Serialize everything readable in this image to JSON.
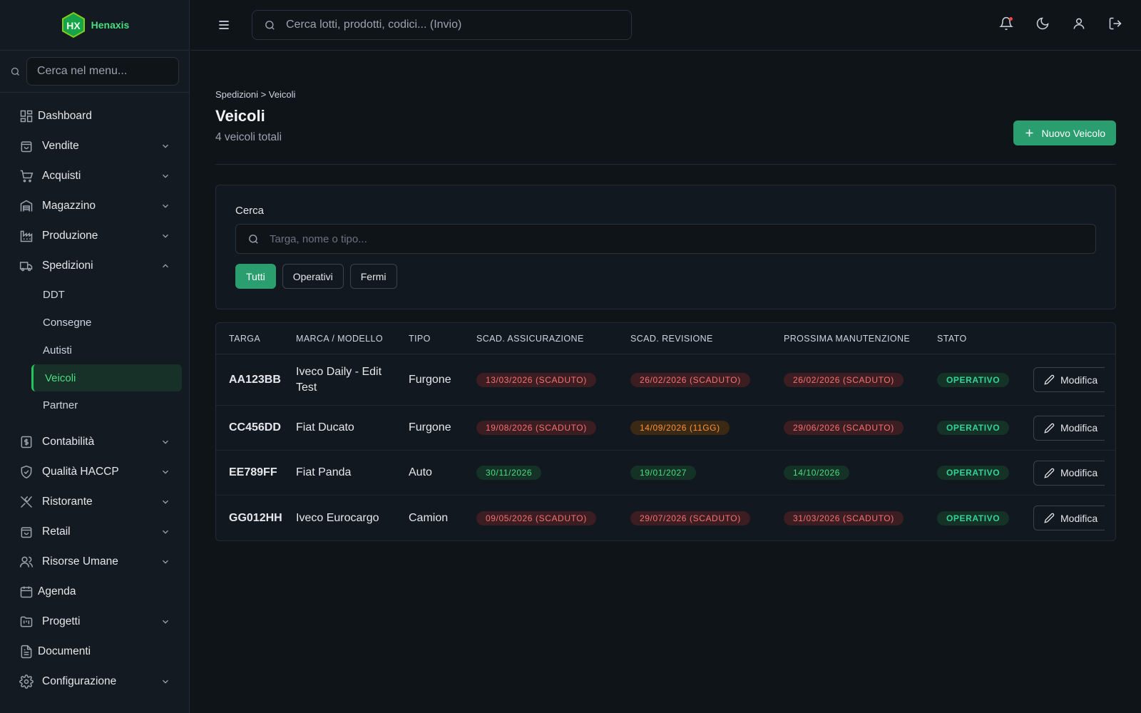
{
  "brand": {
    "logo_text": "HX",
    "name": "Henaxis"
  },
  "sidebar": {
    "search_placeholder": "Cerca nel menu...",
    "items": [
      {
        "label": "Dashboard"
      },
      {
        "label": "Vendite"
      },
      {
        "label": "Acquisti"
      },
      {
        "label": "Magazzino"
      },
      {
        "label": "Produzione"
      },
      {
        "label": "Spedizioni"
      },
      {
        "label": "Contabilità"
      },
      {
        "label": "Qualità HACCP"
      },
      {
        "label": "Ristorante"
      },
      {
        "label": "Retail"
      },
      {
        "label": "Risorse Umane"
      },
      {
        "label": "Agenda"
      },
      {
        "label": "Progetti"
      },
      {
        "label": "Documenti"
      },
      {
        "label": "Configurazione"
      }
    ],
    "sub_items": [
      {
        "label": "DDT"
      },
      {
        "label": "Consegne"
      },
      {
        "label": "Autisti"
      },
      {
        "label": "Veicoli"
      },
      {
        "label": "Partner"
      }
    ]
  },
  "topbar": {
    "search_placeholder": "Cerca lotti, prodotti, codici... (Invio)"
  },
  "page": {
    "breadcrumb": "Spedizioni > Veicoli",
    "title": "Veicoli",
    "subtitle": "4 veicoli totali",
    "new_button": "Nuovo Veicolo"
  },
  "filters": {
    "label": "Cerca",
    "placeholder": "Targa, nome o tipo...",
    "chips": [
      "Tutti",
      "Operativi",
      "Fermi"
    ]
  },
  "table": {
    "headers": [
      "TARGA",
      "MARCA / MODELLO",
      "TIPO",
      "SCAD. ASSICURAZIONE",
      "SCAD. REVISIONE",
      "PROSSIMA MANUTENZIONE",
      "STATO"
    ],
    "edit_label": "Modifica",
    "rows": [
      {
        "targa": "AA123BB",
        "modello": "Iveco Daily - Edit Test",
        "tipo": "Furgone",
        "assicurazione": "13/03/2026 (SCADUTO)",
        "revisione": "26/02/2026 (SCADUTO)",
        "manutenzione": "26/02/2026 (SCADUTO)",
        "stato": "OPERATIVO"
      },
      {
        "targa": "CC456DD",
        "modello": "Fiat Ducato",
        "tipo": "Furgone",
        "assicurazione": "19/08/2026 (SCADUTO)",
        "revisione": "14/09/2026 (11GG)",
        "manutenzione": "29/06/2026 (SCADUTO)",
        "stato": "OPERATIVO"
      },
      {
        "targa": "EE789FF",
        "modello": "Fiat Panda",
        "tipo": "Auto",
        "assicurazione": "30/11/2026",
        "revisione": "19/01/2027",
        "manutenzione": "14/10/2026",
        "stato": "OPERATIVO"
      },
      {
        "targa": "GG012HH",
        "modello": "Iveco Eurocargo",
        "tipo": "Camion",
        "assicurazione": "09/05/2026 (SCADUTO)",
        "revisione": "29/07/2026 (SCADUTO)",
        "manutenzione": "31/03/2026 (SCADUTO)",
        "stato": "OPERATIVO"
      }
    ]
  },
  "colors": {
    "accent": "#2b9e6f",
    "expired": "#f87171",
    "ok": "#4ade80",
    "warning": "#fb923c"
  }
}
